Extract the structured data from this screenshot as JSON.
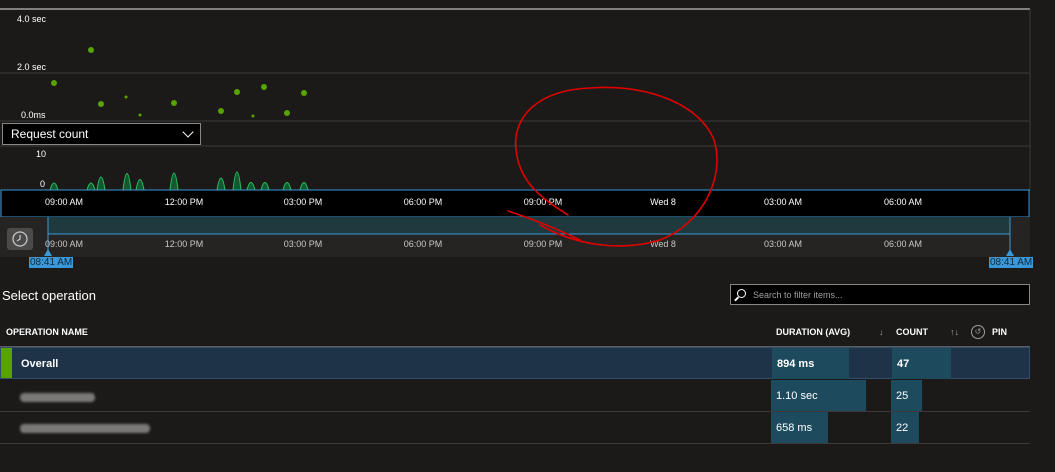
{
  "duration_chart": {
    "y_labels": [
      "4.0 sec",
      "2.0 sec",
      "0.0ms"
    ]
  },
  "metric_dropdown": {
    "value": "Request count"
  },
  "count_chart": {
    "y_labels": [
      "10",
      "0"
    ]
  },
  "time_axis": {
    "ticks": [
      "09:00 AM",
      "12:00 PM",
      "03:00 PM",
      "06:00 PM",
      "09:00 PM",
      "Wed 8",
      "03:00 AM",
      "06:00 AM"
    ]
  },
  "range_selector": {
    "ticks": [
      "09:00 AM",
      "12:00 PM",
      "03:00 PM",
      "06:00 PM",
      "09:00 PM",
      "Wed 8",
      "03:00 AM",
      "06:00 AM"
    ],
    "start_label": "08:41 AM",
    "end_label": "08:41 AM"
  },
  "operations": {
    "title": "Select operation",
    "search_placeholder": "Search to filter items...",
    "columns": {
      "name": "OPERATION NAME",
      "duration": "DURATION (AVG)",
      "count": "COUNT",
      "pin": "PIN"
    },
    "rows": [
      {
        "name": "Overall",
        "duration": "894 ms",
        "count": "47",
        "duration_fraction": 0.81,
        "count_fraction": 1.0
      },
      {
        "name": "",
        "duration": "1.10 sec",
        "count": "25",
        "duration_fraction": 1.0,
        "count_fraction": 0.53
      },
      {
        "name": "",
        "duration": "658 ms",
        "count": "22",
        "duration_fraction": 0.6,
        "count_fraction": 0.47
      }
    ]
  },
  "colors": {
    "accent_green": "#57a300",
    "selected_blue": "#3a98d8",
    "annotation_red": "#e00000"
  }
}
